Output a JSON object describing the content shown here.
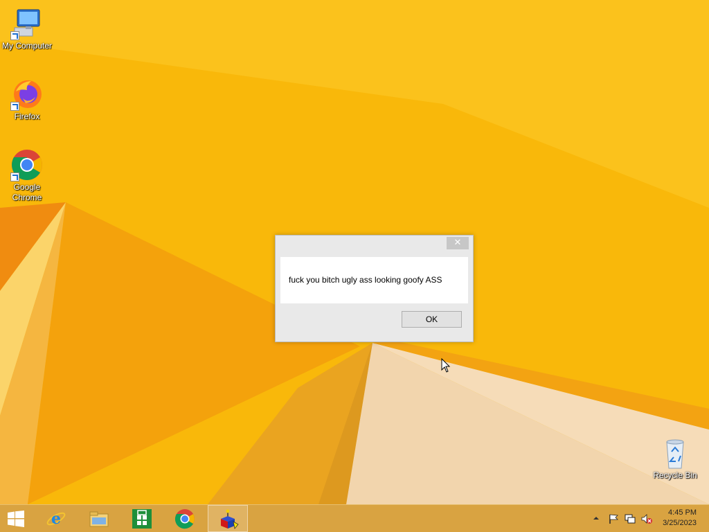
{
  "desktop": {
    "icons": [
      {
        "label": "My Computer"
      },
      {
        "label": "Firefox"
      },
      {
        "label": "Google Chrome"
      },
      {
        "label": "Recycle Bin"
      }
    ]
  },
  "dialog": {
    "close_glyph": "✕",
    "message": "fuck you bitch ugly ass looking goofy ASS",
    "ok_label": "OK"
  },
  "taskbar": {
    "buttons": [
      {
        "icon": "windows-start-icon"
      },
      {
        "icon": "internet-explorer-icon"
      },
      {
        "icon": "file-explorer-icon"
      },
      {
        "icon": "windows-store-icon"
      },
      {
        "icon": "chrome-icon"
      },
      {
        "icon": "app-cube-icon",
        "active": true
      }
    ],
    "tray": {
      "icons": [
        "show-hidden-icons-chevron",
        "action-center-flag-icon",
        "network-icon",
        "volume-muted-icon"
      ],
      "time": "4:45 PM",
      "date": "3/25/2023"
    }
  },
  "colors": {
    "wallpaper": "#f8b500",
    "taskbar": "#d9a341",
    "dialog_bg": "#e9e9e9",
    "close_button": "#c7c7c7"
  }
}
